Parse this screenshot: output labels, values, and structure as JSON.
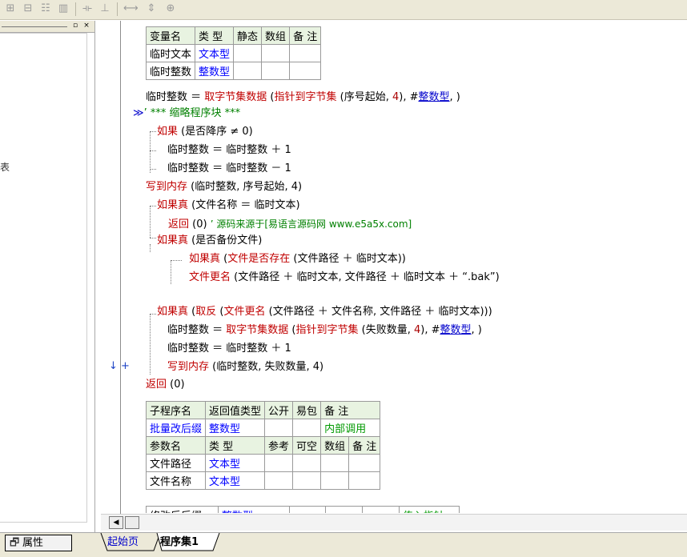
{
  "toolbar": {
    "icons": [
      "table-insert-icon",
      "table-col-icon",
      "table-row-icon",
      "table-split-icon",
      "align-h-icon",
      "align-v-icon",
      "stretch-h-icon",
      "stretch-v-icon",
      "fit-icon"
    ]
  },
  "left_panel": {
    "min_label": "▫",
    "close_label": "×",
    "tree_char": "表"
  },
  "var_table": {
    "headers": [
      "变量名",
      "类 型",
      "静态",
      "数组",
      "备 注"
    ],
    "rows": [
      [
        "临时文本",
        "文本型",
        "",
        "",
        ""
      ],
      [
        "临时整数",
        "整数型",
        "",
        "",
        ""
      ]
    ]
  },
  "code": {
    "l1_a": "临时整数 ＝ ",
    "l1_b": "取字节集数据",
    "l1_c": " (",
    "l1_d": "指针到字节集",
    "l1_e": " (序号起始, ",
    "l1_f": "4",
    "l1_g": "), #",
    "l1_h": "整数型",
    "l1_i": ", )",
    "l2_mark": "≫",
    "l2_text": "’ *** 缩略程序块 ***",
    "l3_a": "如果",
    "l3_b": " (是否降序 ≠ 0)",
    "l4": "临时整数 ＝ 临时整数 ＋ 1",
    "l5": "临时整数 ＝ 临时整数 － 1",
    "l6_a": "写到内存",
    "l6_b": " (临时整数, 序号起始, 4)",
    "l7_a": "如果真",
    "l7_b": " (文件名称 ＝ 临时文本)",
    "l8_a": "返回",
    "l8_b": " (0) ",
    "l8_c": "’ 源码来源于[易语言源码网 www.e5a5x.com]",
    "l9_a": "如果真",
    "l9_b": " (是否备份文件)",
    "l10_a": "如果真",
    "l10_b": " (",
    "l10_c": "文件是否存在",
    "l10_d": " (文件路径 ＋ 临时文本))",
    "l11_a": "文件更名",
    "l11_b": " (文件路径 ＋ 临时文本, 文件路径 ＋ 临时文本 ＋ “.bak”)",
    "l12_a": "如果真",
    "l12_b": " (",
    "l12_c": "取反",
    "l12_d": " (",
    "l12_e": "文件更名",
    "l12_f": " (文件路径 ＋ 文件名称, 文件路径 ＋ 临时文本)))",
    "l13_a": "临时整数 ＝ ",
    "l13_b": "取字节集数据",
    "l13_c": " (",
    "l13_d": "指针到字节集",
    "l13_e": " (失败数量, ",
    "l13_f": "4",
    "l13_g": "), #",
    "l13_h": "整数型",
    "l13_i": ", )",
    "l14": "临时整数 ＝ 临时整数 ＋ 1",
    "l15_a": "写到内存",
    "l15_b": " (临时整数, 失败数量, 4)",
    "l16_a": "返回",
    "l16_b": " (0)",
    "margin_marker": "↓ +"
  },
  "sub_table": {
    "headers": [
      "子程序名",
      "返回值类型",
      "公开",
      "易包",
      "备 注"
    ],
    "row": [
      "批量改后缀",
      "整数型",
      "",
      "",
      "内部调用"
    ],
    "param_headers": [
      "参数名",
      "类 型",
      "参考",
      "可空",
      "数组",
      "备 注"
    ],
    "params": [
      [
        "文件路径",
        "文本型",
        "",
        "",
        "",
        ""
      ],
      [
        "文件名称",
        "文本型",
        "",
        "",
        "",
        ""
      ],
      [
        "修改后后缀",
        "整数型",
        "",
        "",
        "",
        "传入指针"
      ]
    ]
  },
  "bottom": {
    "prop_label": "属性",
    "tab_start": "起始页",
    "tab_prog": "程序集1",
    "scroll_left": "◀"
  },
  "colors": {
    "keyword": "#c00000",
    "type": "#0000ff",
    "comment": "#008000",
    "header_bg": "#e8f3e1"
  }
}
